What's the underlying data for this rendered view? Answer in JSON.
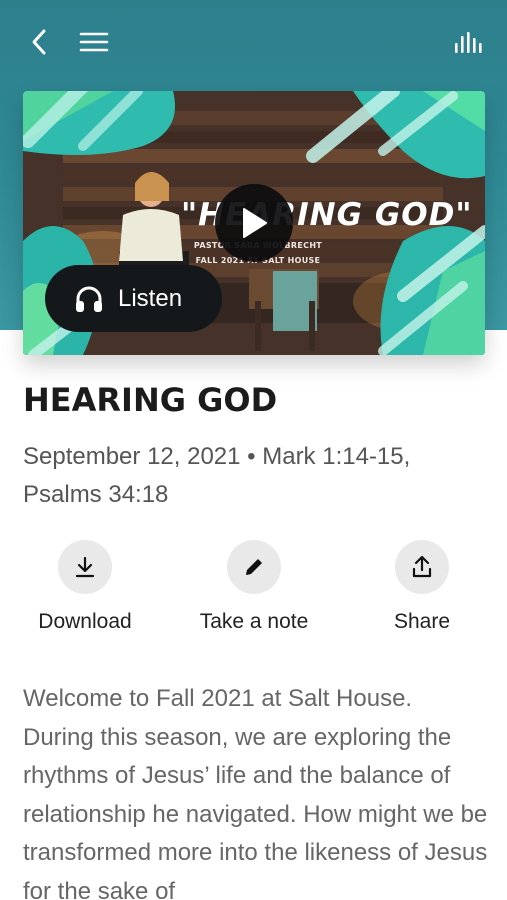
{
  "topbar": {
    "back_icon": "chevron-left-icon",
    "menu_icon": "hamburger-menu-icon",
    "stats_icon": "equalizer-bars-icon"
  },
  "hero": {
    "graphic_title": "\"HEARING GOD\"",
    "graphic_line1": "PASTOR SARA WOLBRECHT",
    "graphic_line2": "FALL 2021 AT SALT HOUSE",
    "play_icon": "play-icon",
    "listen_label": "Listen",
    "listen_icon": "headphones-icon"
  },
  "sermon": {
    "title": "HEARING GOD",
    "meta": "September 12, 2021 • Mark 1:14-15, Psalms 34:18"
  },
  "actions": {
    "download_label": "Download",
    "note_label": "Take a note",
    "share_label": "Share"
  },
  "description": "Welcome to Fall 2021 at Salt House. During this season, we are exploring the rhythms of Jesus’ life and the balance of relationship he navigated. How might we be transformed more into the likeness of Jesus for the sake of"
}
